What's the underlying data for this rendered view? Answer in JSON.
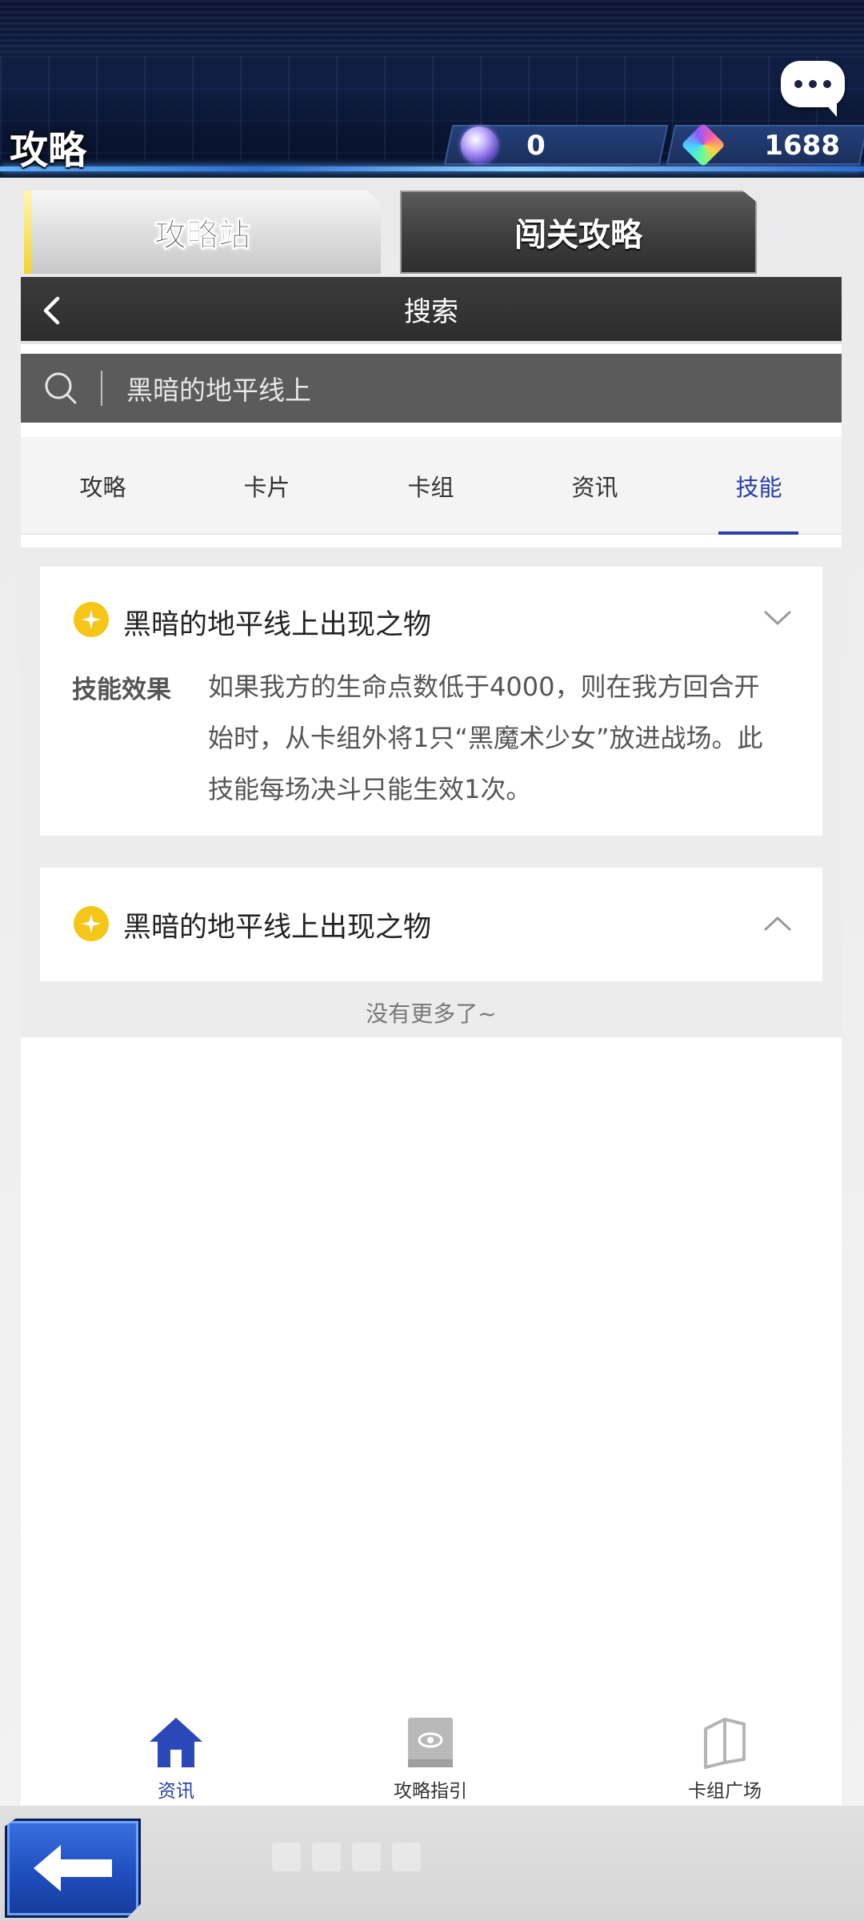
{
  "header": {
    "title": "攻略",
    "currency_orb": "0",
    "currency_gem": "1688",
    "icons": [
      "chat-bubble-icon",
      "orb-currency-icon",
      "gem-currency-icon"
    ]
  },
  "top_tabs": [
    {
      "label": "攻略站",
      "active": true
    },
    {
      "label": "闯关攻略",
      "active": false
    }
  ],
  "search": {
    "title": "搜索",
    "query": "黑暗的地平线上"
  },
  "result_tabs": [
    {
      "label": "攻略",
      "active": false
    },
    {
      "label": "卡片",
      "active": false
    },
    {
      "label": "卡组",
      "active": false
    },
    {
      "label": "资讯",
      "active": false
    },
    {
      "label": "技能",
      "active": true
    }
  ],
  "results": [
    {
      "title": "黑暗的地平线上出现之物",
      "expanded": true,
      "effect_label": "技能效果",
      "effect_text": "如果我方的生命点数低于4000，则在我方回合开始时，从卡组外将1只“黑魔术少女”放进战场。此技能每场决斗只能生效1次。"
    },
    {
      "title": "黑暗的地平线上出现之物",
      "expanded": false
    }
  ],
  "end_text": "没有更多了~",
  "bottom_nav": [
    {
      "label": "资讯",
      "icon": "home-icon",
      "active": true
    },
    {
      "label": "攻略指引",
      "icon": "guide-book-icon",
      "active": false
    },
    {
      "label": "卡组广场",
      "icon": "card-deck-icon",
      "active": false
    }
  ],
  "colors": {
    "accent": "#2740a8",
    "badge": "#f5c518",
    "header_bg": "#0e1a3c"
  }
}
